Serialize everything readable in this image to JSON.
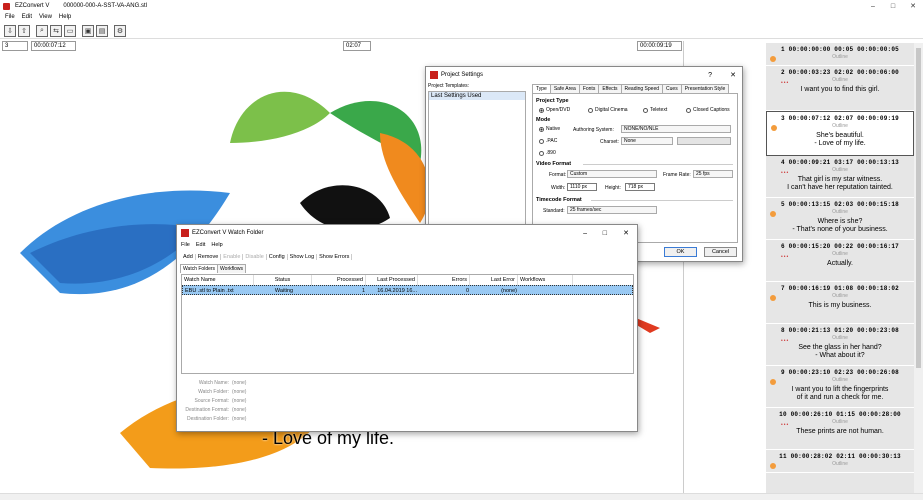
{
  "app": {
    "title": "EZConvert V",
    "filename": "000000-000-A-SST-VA-ANG.stl"
  },
  "menu": [
    "File",
    "Edit",
    "View",
    "Help"
  ],
  "timecodes": {
    "index": "3",
    "tc_in": "00:00:07:12",
    "duration": "02:07",
    "tc_out": "00:00:09:19"
  },
  "preview": {
    "subtitle": "- Love of my life."
  },
  "subtitles": [
    {
      "num": "1",
      "tc_in": "00:00:00:00",
      "dur": "00:05",
      "tc_out": "00:00:00:05",
      "style": "Outline",
      "text": ""
    },
    {
      "num": "2",
      "tc_in": "00:00:03:23",
      "dur": "02:02",
      "tc_out": "00:00:06:00",
      "style": "Outline",
      "text": "I want you to find this girl."
    },
    {
      "num": "3",
      "tc_in": "00:00:07:12",
      "dur": "02:07",
      "tc_out": "00:00:09:19",
      "style": "Outline",
      "text": "She's beautiful.\n- Love of my life."
    },
    {
      "num": "4",
      "tc_in": "00:00:09:21",
      "dur": "03:17",
      "tc_out": "00:00:13:13",
      "style": "Outline",
      "text": "That girl is my star witness.\nI can't have her reputation tainted."
    },
    {
      "num": "5",
      "tc_in": "00:00:13:15",
      "dur": "02:03",
      "tc_out": "00:00:15:18",
      "style": "Outline",
      "text": "Where is she?\n- That's none of your business."
    },
    {
      "num": "6",
      "tc_in": "00:00:15:20",
      "dur": "00:22",
      "tc_out": "00:00:16:17",
      "style": "Outline",
      "text": "Actually."
    },
    {
      "num": "7",
      "tc_in": "00:00:16:19",
      "dur": "01:08",
      "tc_out": "00:00:18:02",
      "style": "Outline",
      "text": "This is my business."
    },
    {
      "num": "8",
      "tc_in": "00:00:21:13",
      "dur": "01:20",
      "tc_out": "00:00:23:08",
      "style": "Outline",
      "text": "See the glass in her hand?\n- What about it?"
    },
    {
      "num": "9",
      "tc_in": "00:00:23:10",
      "dur": "02:23",
      "tc_out": "00:00:26:08",
      "style": "Outline",
      "text": "I want you to lift the fingerprints\nof it and run a check for me."
    },
    {
      "num": "10",
      "tc_in": "00:00:26:10",
      "dur": "01:15",
      "tc_out": "00:00:28:00",
      "style": "Outline",
      "text": "These prints are not human."
    },
    {
      "num": "11",
      "tc_in": "00:00:28:02",
      "dur": "02:11",
      "tc_out": "00:00:30:13",
      "style": "Outline",
      "text": ""
    }
  ],
  "project_settings": {
    "title": "Project Settings",
    "templates_label": "Project Templates:",
    "template_item": "Last Settings Used",
    "tabs": [
      "Type",
      "Safe Area",
      "Fonts",
      "Effects",
      "Reading Speed",
      "Cues",
      "Presentation Style"
    ],
    "project_type_label": "Project Type",
    "types": [
      "Open/DVD",
      "Digital Cinema",
      "Teletext",
      "Closed Captions"
    ],
    "mode_label": "Mode",
    "modes": [
      "Native",
      ".PAC",
      ".890"
    ],
    "authoring_label": "Authoring System:",
    "authoring_value": "NONE/NO/NLE",
    "charset_label": "Charset:",
    "charset_value": "None",
    "video_label": "Video Format",
    "format_label": "Format:",
    "format_value": "Custom",
    "framerate_label": "Frame Rate:",
    "framerate_value": "25 fps",
    "width_label": "Width:",
    "width_value": "1110 px",
    "height_label": "Height:",
    "height_value": "718 px",
    "timecode_label": "Timecode Format",
    "standard_label": "Standard:",
    "standard_value": "25 frames/sec",
    "ok": "OK",
    "cancel": "Cancel"
  },
  "watch_folder": {
    "title": "EZConvert V Watch Folder",
    "menu": [
      "File",
      "Edit",
      "Help"
    ],
    "toolbar": [
      "Add",
      "Remove",
      "Enable",
      "Disable",
      "Config",
      "Show Log",
      "Show Errors"
    ],
    "tabs": [
      "Watch Folders",
      "Workflows"
    ],
    "columns": [
      "Watch Name",
      "Status",
      "Processed",
      "Last Processed",
      "Errors",
      "Last Error",
      "Workflows"
    ],
    "row": {
      "name": "EBU .stl to Plain .txt",
      "status": "Waiting",
      "processed": "1",
      "last": "16.04.2019  16...",
      "errors": "0",
      "last_error": "(none)",
      "workflows": ""
    },
    "details": [
      {
        "label": "Watch Name:",
        "value": "(none)"
      },
      {
        "label": "Watch Folder:",
        "value": "(none)"
      },
      {
        "label": "Source Format:",
        "value": "(none)"
      },
      {
        "label": "Destination Format:",
        "value": "(none)"
      },
      {
        "label": "Destination Folder:",
        "value": "(none)"
      }
    ]
  }
}
